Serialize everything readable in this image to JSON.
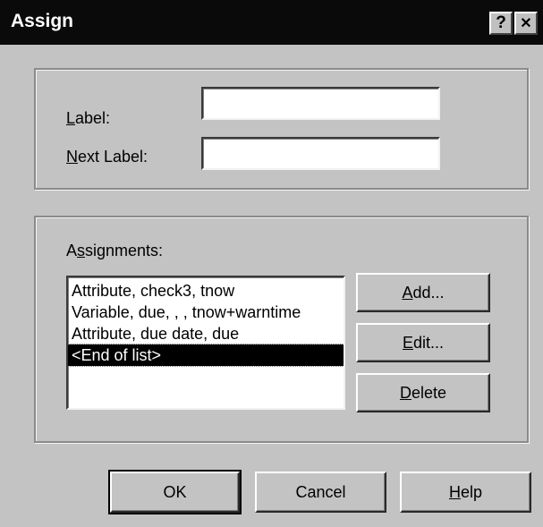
{
  "window": {
    "title": "Assign",
    "help_button": "?",
    "close_button": "✕"
  },
  "label_group": {
    "label_prefix": "",
    "label_mnemonic": "L",
    "label_rest": "abel:",
    "label_value": "",
    "next_label_mnemonic": "N",
    "next_label_rest": "ext Label:",
    "next_label_value": ""
  },
  "assignments": {
    "heading_first": "A",
    "heading_mnemonic": "s",
    "heading_rest": "signments:",
    "items": [
      "Attribute, check3, tnow",
      "Variable, due, , , tnow+warntime",
      "Attribute, due date, due",
      "<End of list>"
    ],
    "selected_index": 3,
    "add_mnemonic": "A",
    "add_rest": "dd...",
    "edit_mnemonic": "E",
    "edit_rest": "dit...",
    "delete_mnemonic": "D",
    "delete_rest": "elete"
  },
  "footer": {
    "ok_label": "OK",
    "cancel_label": "Cancel",
    "help_mnemonic": "H",
    "help_rest": "elp"
  }
}
